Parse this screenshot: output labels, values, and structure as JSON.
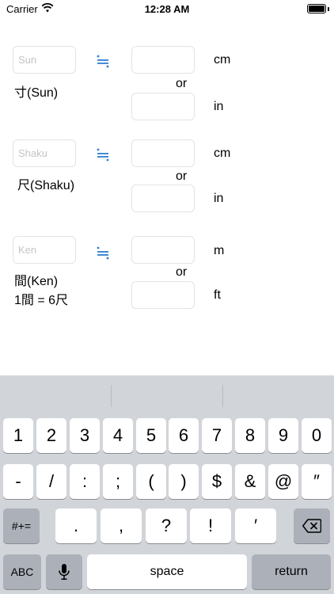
{
  "status_bar": {
    "carrier": "Carrier",
    "time": "12:28 AM"
  },
  "approx_symbol": "≒",
  "connector": "or",
  "rows": [
    {
      "placeholder": "Sun",
      "label_lines": [
        "寸(Sun)"
      ],
      "units": [
        "cm",
        "in"
      ]
    },
    {
      "placeholder": "Shaku",
      "label_lines": [
        "尺(Shaku)"
      ],
      "units": [
        "cm",
        "in"
      ]
    },
    {
      "placeholder": "Ken",
      "label_lines": [
        "間(Ken)",
        "1間 = 6尺"
      ],
      "units": [
        "m",
        "ft"
      ]
    }
  ],
  "keyboard": {
    "row1": [
      "1",
      "2",
      "3",
      "4",
      "5",
      "6",
      "7",
      "8",
      "9",
      "0"
    ],
    "row2": [
      "-",
      "/",
      ":",
      ";",
      "(",
      ")",
      "$",
      "&",
      "@",
      "″"
    ],
    "row3_left": "#+=",
    "row3": [
      ".",
      ",",
      "?",
      "!",
      "′"
    ],
    "row3_right_icon": "backspace-icon",
    "abc": "ABC",
    "mic_icon": "microphone-icon",
    "space": "space",
    "return": "return"
  }
}
